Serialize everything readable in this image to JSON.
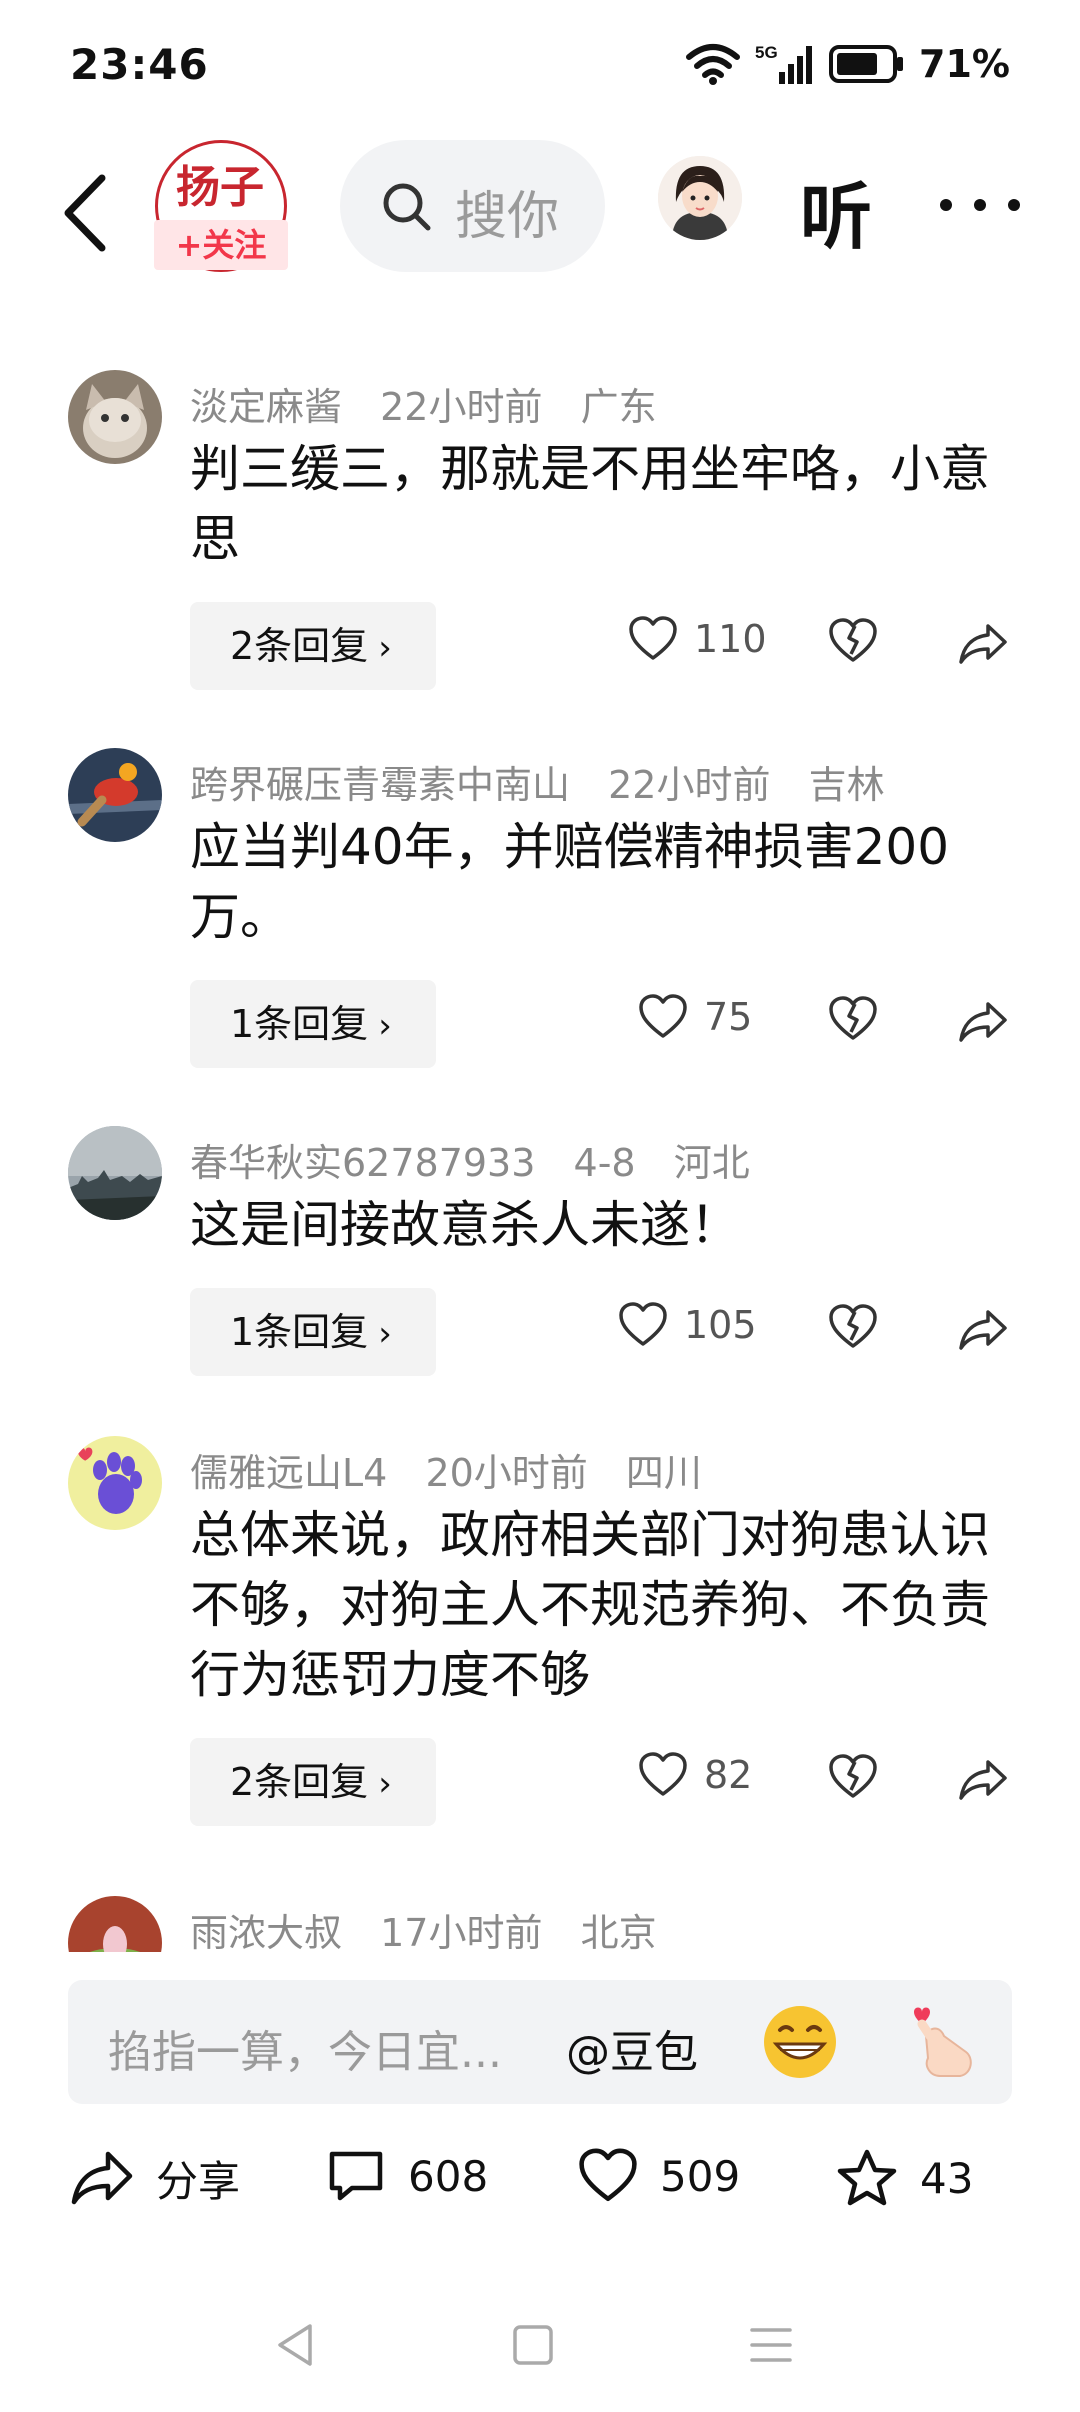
{
  "status_bar": {
    "time": "23:46",
    "network": "5G",
    "battery": "71%"
  },
  "header": {
    "logo_text": "扬子",
    "follow_label": "+关注",
    "search_placeholder": "搜你",
    "listen_label": "听"
  },
  "comments": [
    {
      "user": "淡定麻酱",
      "time": "22小时前",
      "location": "广东",
      "text": "判三缓三，那就是不用坐牢咯，小意思",
      "replies": "2条回复",
      "likes": "110"
    },
    {
      "user": "跨界碾压青霉素中南山",
      "time": "22小时前",
      "location": "吉林",
      "text": "应当判40年，并赔偿精神损害200万。",
      "replies": "1条回复",
      "likes": "75"
    },
    {
      "user": "春华秋实62787933",
      "time": "4-8",
      "location": "河北",
      "text": "这是间接故意杀人未遂！",
      "replies": "1条回复",
      "likes": "105"
    },
    {
      "user": "儒雅远山L4",
      "time": "20小时前",
      "location": "四川",
      "text": "总体来说，政府相关部门对狗患认识不够，对狗主人不规范养狗、不负责行为惩罚力度不够",
      "replies": "2条回复",
      "likes": "82"
    },
    {
      "user": "雨浓大叔",
      "time": "17小时前",
      "location": "北京"
    }
  ],
  "input": {
    "placeholder": "掐指一算，今日宜...",
    "mention": "@豆包"
  },
  "toolbar": {
    "share_label": "分享",
    "comments_count": "608",
    "likes_count": "509",
    "favorites_count": "43"
  },
  "colors": {
    "follow_red": "#f2374a",
    "text_gray": "#8a8a8a",
    "bg_gray": "#f2f3f5"
  },
  "icons": [
    "back-arrow-icon",
    "search-icon",
    "heart-icon",
    "broken-heart-icon",
    "share-arrow-icon",
    "comment-bubble-icon",
    "star-icon",
    "grin-emoji-icon",
    "finger-heart-emoji-icon"
  ]
}
